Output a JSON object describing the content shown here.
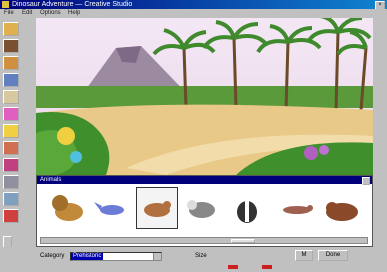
{
  "window": {
    "title": "Dinosaur Adventure — Creative Studio"
  },
  "menu": {
    "items": [
      "File",
      "Edit",
      "Options",
      "Help"
    ]
  },
  "stamp_panel": {
    "title": "Animals"
  },
  "status": {
    "label": "Category",
    "selected": "Prehistoric",
    "right_label": "Size"
  },
  "buttons": {
    "small": "M",
    "done": "Done"
  },
  "colors": {
    "title_bar": "#00007b",
    "sand": "#e8c987",
    "grass": "#3f8f2c"
  }
}
